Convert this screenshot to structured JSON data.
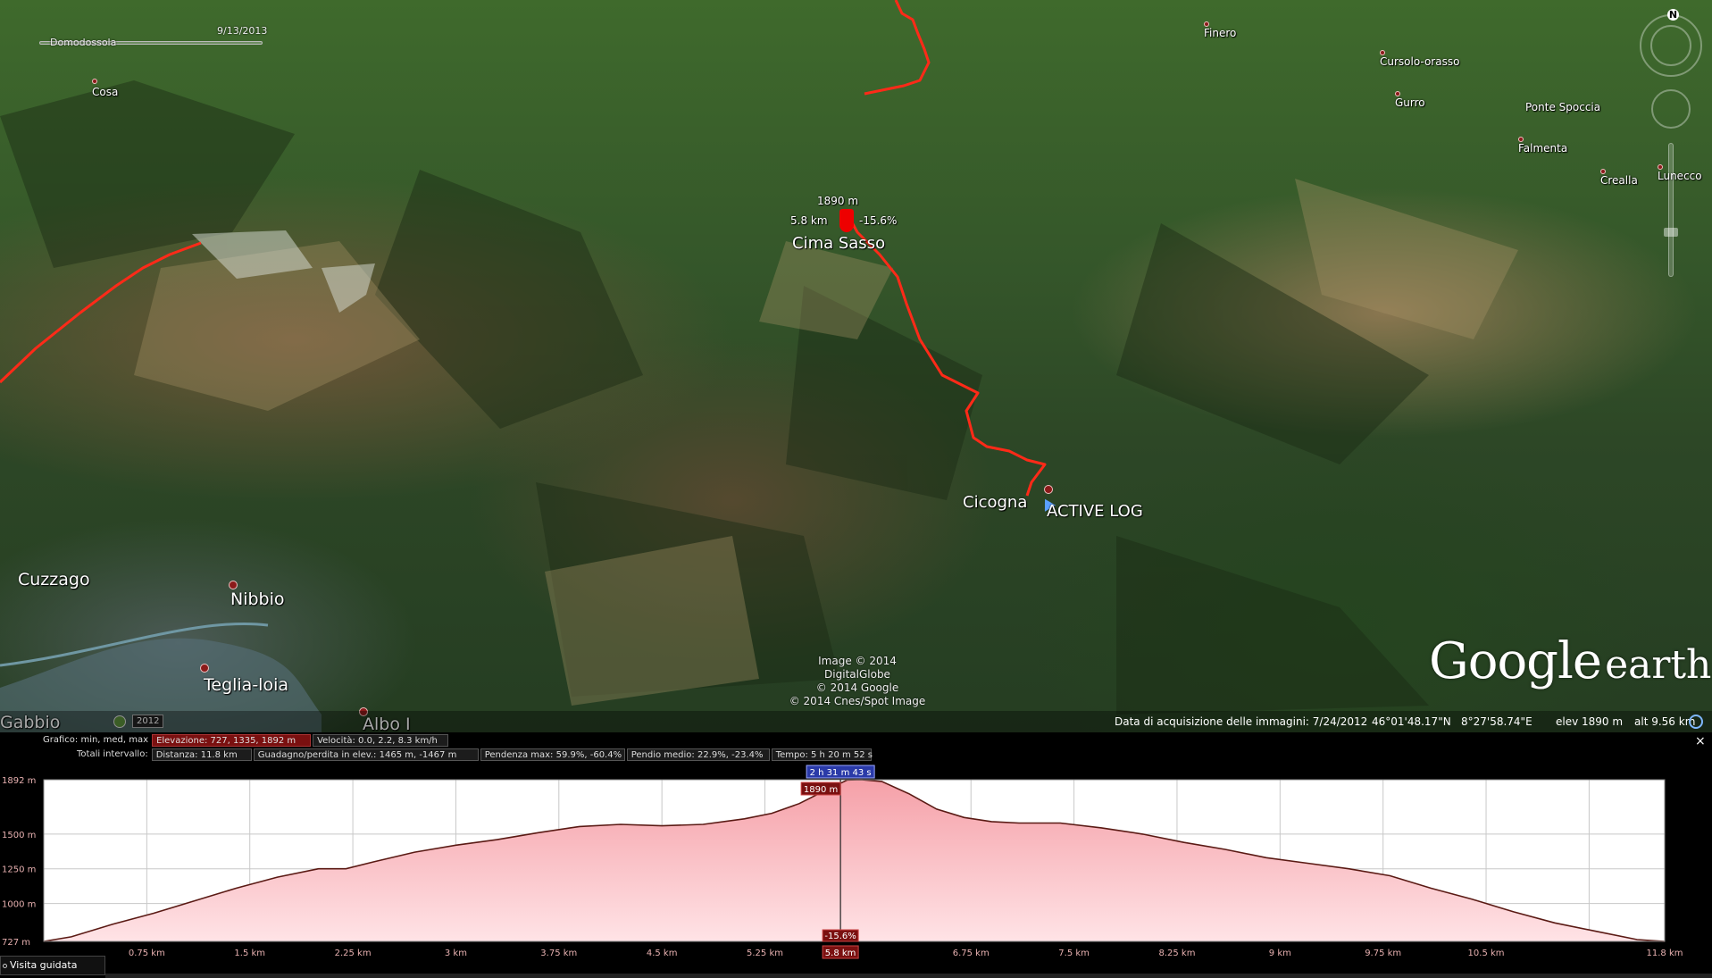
{
  "map": {
    "date_slider": {
      "date": "9/13/2013",
      "location": "Domodossola"
    },
    "places": {
      "cosa": "Cosa",
      "finero": "Finero",
      "cursolo": "Cursolo-orasso",
      "gurro": "Gurro",
      "ponte_spoccia": "Ponte Spoccia",
      "falmenta": "Falmenta",
      "crealla": "Crealla",
      "lunecco": "Lunecco",
      "cima_sasso": "Cima Sasso",
      "cicogna": "Cicogna",
      "active_log": "ACTIVE LOG",
      "cuzzago": "Cuzzago",
      "nibbio": "Nibbio",
      "teglia": "Teglia-loia",
      "gabbio": "Gabbio",
      "albo": "Albo I"
    },
    "marker_readout": {
      "elevation": "1890 m",
      "distance": "5.8 km",
      "grade": "-15.6%"
    },
    "attribution": [
      "Image © 2014 DigitalGlobe",
      "© 2014 Google",
      "© 2014 Cnes/Spot Image"
    ],
    "logo": {
      "word1": "Google",
      "word2": "earth"
    },
    "year_badge": "2012",
    "north_label": "N"
  },
  "status_bar": {
    "acquisition": "Data di acquisizione delle immagini: 7/24/2012",
    "lat": "46°01'48.17\"N",
    "lon": "8°27'58.74\"E",
    "elev": "elev   1890 m",
    "alt": "alt   9.56 km"
  },
  "profile": {
    "close_label": "×",
    "row1": {
      "label": "Grafico: min, med, max",
      "elevation": "Elevazione: 727, 1335, 1892 m",
      "speed": "Velocità: 0.0, 2.2, 8.3 km/h"
    },
    "row2": {
      "label": "Totali intervallo:",
      "distance": "Distanza: 11.8 km",
      "gain_loss": "Guadagno/perdita in elev.: 1465 m, -1467 m",
      "max_slope": "Pendenza max: 59.9%, -60.4%",
      "avg_slope": "Pendio medio: 22.9%, -23.4%",
      "time": "Tempo: 5 h 20 m 52 s"
    },
    "cursor": {
      "time": "2 h 31 m 43 s",
      "elevation": "1890 m",
      "grade": "-15.6%",
      "distance": "5.8 km",
      "x_km": 5.8
    },
    "tour_button": "Visita guidata"
  },
  "chart_data": {
    "type": "area",
    "x_unit": "km",
    "y_unit": "m",
    "xlim": [
      0,
      11.8
    ],
    "ylim": [
      727,
      1892
    ],
    "y_ticks": [
      {
        "value": 1892,
        "label": "1892 m"
      },
      {
        "value": 1500,
        "label": "1500 m"
      },
      {
        "value": 1250,
        "label": "1250 m"
      },
      {
        "value": 1000,
        "label": "1000 m"
      },
      {
        "value": 727,
        "label": "727 m"
      }
    ],
    "x_ticks": [
      {
        "value": 0.75,
        "label": "0.75 km"
      },
      {
        "value": 1.5,
        "label": "1.5 km"
      },
      {
        "value": 2.25,
        "label": "2.25 km"
      },
      {
        "value": 3,
        "label": "3 km"
      },
      {
        "value": 3.75,
        "label": "3.75 km"
      },
      {
        "value": 4.5,
        "label": "4.5 km"
      },
      {
        "value": 5.25,
        "label": "5.25 km"
      },
      {
        "value": 6.75,
        "label": "6.75 km"
      },
      {
        "value": 7.5,
        "label": "7.5 km"
      },
      {
        "value": 8.25,
        "label": "8.25 km"
      },
      {
        "value": 9,
        "label": "9 km"
      },
      {
        "value": 9.75,
        "label": "9.75 km"
      },
      {
        "value": 10.5,
        "label": "10.5 km"
      },
      {
        "value": 11.8,
        "label": "11.8 km"
      }
    ],
    "x": [
      0,
      0.2,
      0.5,
      0.8,
      1.1,
      1.4,
      1.7,
      2.0,
      2.2,
      2.4,
      2.7,
      3.0,
      3.3,
      3.6,
      3.9,
      4.2,
      4.5,
      4.8,
      5.1,
      5.3,
      5.5,
      5.7,
      5.85,
      5.95,
      6.1,
      6.3,
      6.5,
      6.7,
      6.9,
      7.1,
      7.4,
      7.7,
      8.0,
      8.3,
      8.6,
      8.9,
      9.2,
      9.5,
      9.8,
      10.1,
      10.4,
      10.7,
      11.0,
      11.3,
      11.6,
      11.8
    ],
    "y": [
      727,
      760,
      850,
      930,
      1020,
      1110,
      1190,
      1250,
      1250,
      1300,
      1370,
      1420,
      1460,
      1510,
      1555,
      1570,
      1560,
      1570,
      1610,
      1650,
      1720,
      1820,
      1890,
      1892,
      1880,
      1790,
      1680,
      1620,
      1590,
      1580,
      1580,
      1545,
      1500,
      1440,
      1390,
      1330,
      1290,
      1250,
      1200,
      1110,
      1030,
      940,
      860,
      800,
      740,
      727
    ],
    "grid": true,
    "grid_step_x_km": 0.75
  }
}
